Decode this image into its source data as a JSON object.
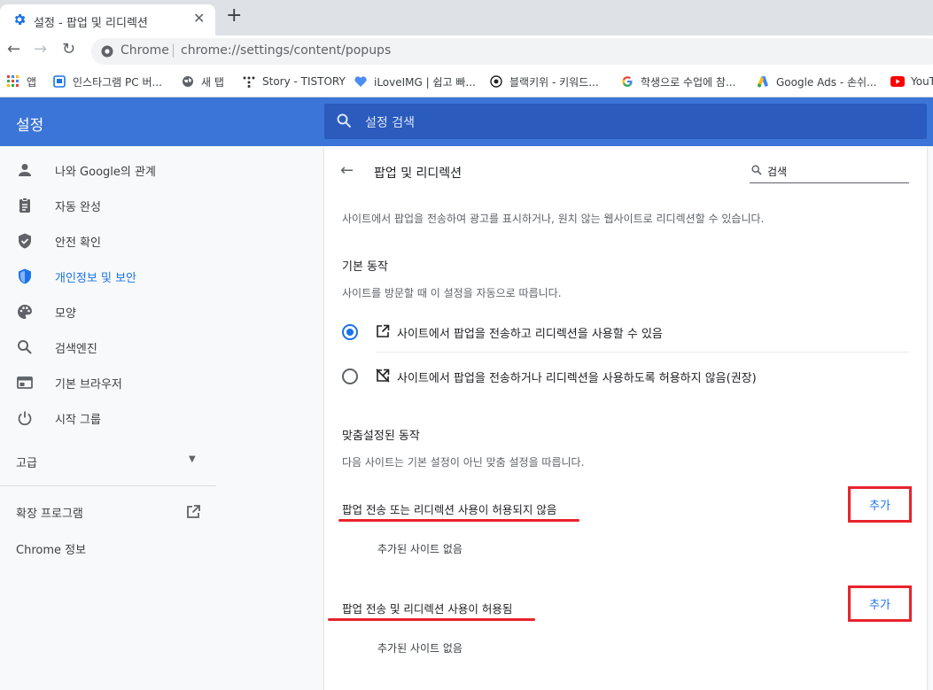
{
  "tab": {
    "title": "설정 - 팝업 및 리디렉션"
  },
  "omnibox": {
    "site": "Chrome",
    "url": "chrome://settings/content/popups"
  },
  "bookmarks": [
    {
      "label": "앱",
      "icon": "apps-grid-icon"
    },
    {
      "label": "인스타그램 PC 버...",
      "icon": "instagram-bookmark-icon"
    },
    {
      "label": "새 탭",
      "icon": "globe-icon"
    },
    {
      "label": "Story - TISTORY",
      "icon": "tistory-icon"
    },
    {
      "label": "iLoveIMG | 쉽고 빠...",
      "icon": "iloveimg-icon"
    },
    {
      "label": "블랙키위 - 키워드...",
      "icon": "blackkiwi-icon"
    },
    {
      "label": "학생으로 수업에 참...",
      "icon": "google-g-icon"
    },
    {
      "label": "Google Ads - 손쉬...",
      "icon": "google-ads-icon"
    },
    {
      "label": "YouT",
      "icon": "youtube-icon"
    }
  ],
  "header": {
    "title": "설정",
    "search_placeholder": "설정 검색"
  },
  "sidebar": {
    "items": [
      {
        "label": "나와 Google의 관계",
        "icon": "person-icon"
      },
      {
        "label": "자동 완성",
        "icon": "clipboard-icon"
      },
      {
        "label": "안전 확인",
        "icon": "shield-check-icon"
      },
      {
        "label": "개인정보 및 보안",
        "icon": "shield-icon"
      },
      {
        "label": "모양",
        "icon": "palette-icon"
      },
      {
        "label": "검색엔진",
        "icon": "search-icon"
      },
      {
        "label": "기본 브라우저",
        "icon": "browser-icon"
      },
      {
        "label": "시작 그룹",
        "icon": "power-icon"
      }
    ],
    "advanced": "고급",
    "extensions": "확장 프로그램",
    "about": "Chrome 정보"
  },
  "page": {
    "title": "팝업 및 리디렉션",
    "search_placeholder": "검색",
    "description": "사이트에서 팝업을 전송하여 광고를 표시하거나, 원치 않는 웹사이트로 리디렉션할 수 있습니다.",
    "default_heading": "기본 동작",
    "default_sub": "사이트를 방문할 때 이 설정을 자동으로 따릅니다.",
    "option_allow": "사이트에서 팝업을 전송하고 리디렉션을 사용할 수 있음",
    "option_block": "사이트에서 팝업을 전송하거나 리디렉션을 사용하도록 허용하지 않음(권장)",
    "custom_heading": "맞춤설정된 동작",
    "custom_sub": "다음 사이트는 기본 설정이 아닌 맞춤 설정을 따릅니다.",
    "blocked_heading": "팝업 전송 또는 리디렉션 사용이 허용되지 않음",
    "allowed_heading": "팝업 전송 및 리디렉션 사용이 허용됨",
    "add_label": "추가",
    "empty_label": "추가된 사이트 없음"
  },
  "colors": {
    "accent": "#1a73e8",
    "header": "#3c75d8",
    "annotation": "#e8232b"
  }
}
